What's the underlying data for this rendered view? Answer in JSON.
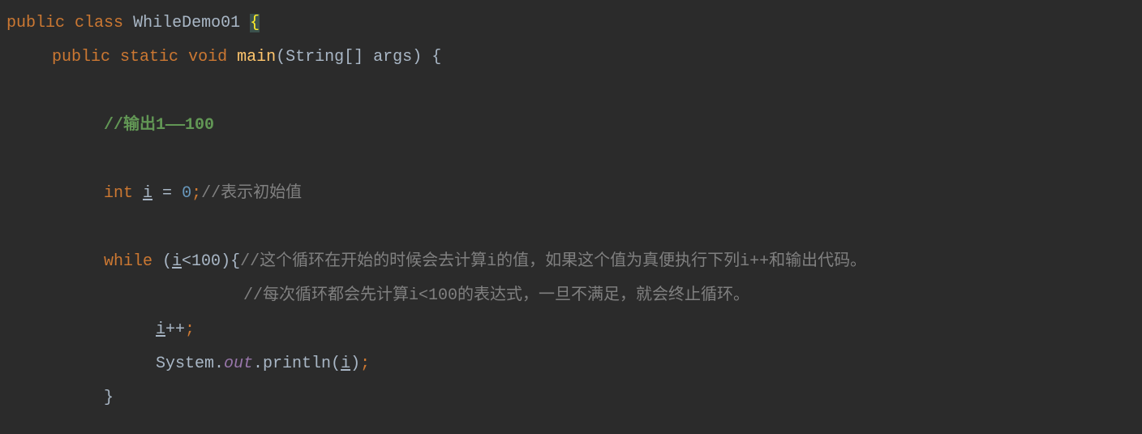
{
  "code": {
    "line1": {
      "kw_public": "public",
      "kw_class": "class",
      "class_name": "WhileDemo01",
      "brace": "{"
    },
    "line2": {
      "kw_public": "public",
      "kw_static": "static",
      "kw_void": "void",
      "method": "main",
      "param_type": "String",
      "brackets": "[]",
      "param_name": "args",
      "brace": "{"
    },
    "line3": {
      "comment": "//输出1——100"
    },
    "line4": {
      "type": "int",
      "var": "i",
      "eq": " = ",
      "val": "0",
      "semi": ";",
      "comment": "//表示初始值"
    },
    "line5": {
      "kw_while": "while",
      "paren_open": " (",
      "var": "i",
      "cond": "<100",
      "paren_close": ")",
      "brace": "{",
      "comment": "//这个循环在开始的时候会去计算i的值，如果这个值为真便执行下列i++和输出代码。"
    },
    "line6": {
      "comment": "//每次循环都会先计算i<100的表达式，一旦不满足，就会终止循环。"
    },
    "line7": {
      "var": "i",
      "op": "++",
      "semi": ";"
    },
    "line8": {
      "sys": "System.",
      "out": "out",
      "println": ".println(",
      "var": "i",
      "close": ")",
      "semi": ";"
    },
    "line9": {
      "brace": "}"
    }
  }
}
